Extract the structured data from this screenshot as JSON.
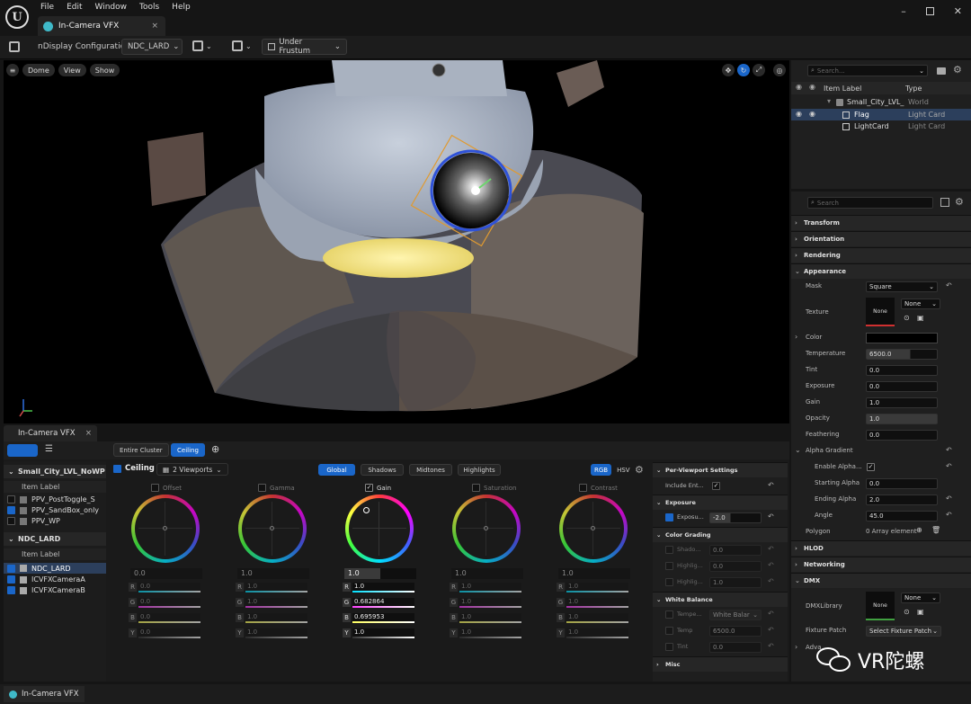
{
  "menu": {
    "items": [
      "File",
      "Edit",
      "Window",
      "Tools",
      "Help"
    ]
  },
  "window": {
    "tab_title": "In-Camera VFX",
    "close_glyph": "×"
  },
  "toolbar": {
    "config_label": "nDisplay Configuration",
    "config_value": "NDC_LARD",
    "frustum_value": "Under Frustum"
  },
  "viewport": {
    "buttons": [
      "Dome",
      "View",
      "Show"
    ]
  },
  "outliner": {
    "search_placeholder": "Search...",
    "col_label": "Item Label",
    "col_type": "Type",
    "rows": [
      {
        "label": "Small_City_LVL_",
        "type": "World"
      },
      {
        "label": "Flag",
        "type": "Light Card"
      },
      {
        "label": "LightCard",
        "type": "Light Card"
      }
    ]
  },
  "details": {
    "search_placeholder": "Search",
    "sections": {
      "transform": "Transform",
      "orientation": "Orientation",
      "rendering": "Rendering",
      "appearance": "Appearance",
      "alpha_gradient": "Alpha Gradient",
      "hlod": "HLOD",
      "networking": "Networking",
      "dmx": "DMX",
      "advanced": "Adva"
    },
    "mask": {
      "label": "Mask",
      "value": "Square"
    },
    "texture": {
      "label": "Texture",
      "thumb": "None",
      "value": "None"
    },
    "color": {
      "label": "Color"
    },
    "temperature": {
      "label": "Temperature",
      "value": "6500.0"
    },
    "tint": {
      "label": "Tint",
      "value": "0.0"
    },
    "exposure": {
      "label": "Exposure",
      "value": "0.0"
    },
    "gain": {
      "label": "Gain",
      "value": "1.0"
    },
    "opacity": {
      "label": "Opacity",
      "value": "1.0"
    },
    "feathering": {
      "label": "Feathering",
      "value": "0.0"
    },
    "enable_alpha": {
      "label": "Enable Alpha..."
    },
    "starting_alpha": {
      "label": "Starting Alpha",
      "value": "0.0"
    },
    "ending_alpha": {
      "label": "Ending Alpha",
      "value": "2.0"
    },
    "angle": {
      "label": "Angle",
      "value": "45.0"
    },
    "polygon": {
      "label": "Polygon",
      "value": "0 Array element"
    },
    "dmx_library": {
      "label": "DMXLibrary",
      "thumb": "None",
      "value": "None"
    },
    "fixture_patch": {
      "label": "Fixture Patch",
      "value": "Select Fixture Patch"
    }
  },
  "icvfx": {
    "tab_title": "In-Camera VFX",
    "tab_close": "×",
    "buttons": {
      "entire_cluster": "Entire Cluster",
      "ceiling": "Ceiling"
    },
    "left_list": {
      "group1_title": "Small_City_LVL_NoWP",
      "group1_header": "Item Label",
      "group1_items": [
        "PPV_PostToggle_S",
        "PPV_SandBox_only",
        "PPV_WP"
      ],
      "group2_title": "NDC_LARD",
      "group2_header": "Item Label",
      "group2_items": [
        "NDC_LARD",
        "ICVFXCameraA",
        "ICVFXCameraB"
      ]
    },
    "grading": {
      "title": "Ceiling",
      "viewports": "2 Viewports",
      "tabs": [
        "Global",
        "Shadows",
        "Midtones",
        "Highlights"
      ],
      "modes": [
        "RGB",
        "HSV"
      ]
    },
    "wheels": [
      {
        "name": "Offset",
        "value": "0.0",
        "r": "0.0",
        "g": "0.0",
        "b": "0.0",
        "y": "0.0"
      },
      {
        "name": "Gamma",
        "value": "1.0",
        "r": "1.0",
        "g": "1.0",
        "b": "1.0",
        "y": "1.0"
      },
      {
        "name": "Gain",
        "value": "1.0",
        "r": "1.0",
        "g": "0.682864",
        "b": "0.695953",
        "y": "1.0"
      },
      {
        "name": "Saturation",
        "value": "1.0",
        "r": "1.0",
        "g": "1.0",
        "b": "1.0",
        "y": "1.0"
      },
      {
        "name": "Contrast",
        "value": "1.0",
        "r": "1.0",
        "g": "1.0",
        "b": "1.0",
        "y": "1.0"
      }
    ],
    "channels": [
      "R",
      "G",
      "B",
      "Y"
    ],
    "per_viewport": {
      "title": "Per-Viewport Settings",
      "include_label": "Include Ent...",
      "exposure_section": "Exposure",
      "exposure_label": "Exposu...",
      "exposure_value": "-2.0",
      "color_grading_section": "Color Grading",
      "cg_rows": [
        {
          "label": "Shado...",
          "value": "0.0"
        },
        {
          "label": "Highlig...",
          "value": "0.0"
        },
        {
          "label": "Highlig...",
          "value": "1.0"
        }
      ],
      "white_balance_section": "White Balance",
      "wb_rows": [
        {
          "label": "Tempe...",
          "value": "White Balar"
        },
        {
          "label": "Temp",
          "value": "6500.0"
        },
        {
          "label": "Tint",
          "value": "0.0"
        }
      ],
      "misc_section": "Misc"
    }
  },
  "statusbar": {
    "tab": "In-Camera VFX"
  },
  "watermark": {
    "text": "VR陀螺"
  }
}
